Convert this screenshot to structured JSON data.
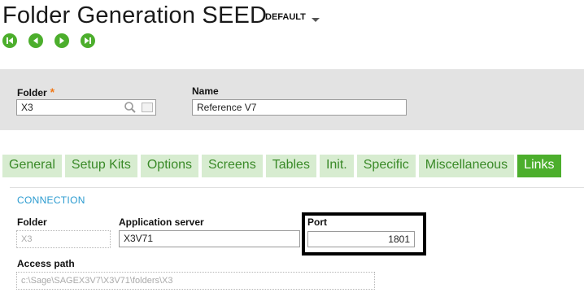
{
  "header": {
    "title": "Folder Generation SEED",
    "variant": "DEFAULT"
  },
  "nav_icons": [
    "first-record-icon",
    "previous-record-icon",
    "next-record-icon",
    "last-record-icon"
  ],
  "colors": {
    "accent": "#4cae2c",
    "tab_inactive": "#d7ecd0",
    "section_title": "#2b9bd0",
    "required": "#f07818"
  },
  "form": {
    "folder_label": "Folder",
    "folder_required_mark": "*",
    "folder_value": "X3",
    "name_label": "Name",
    "name_value": "Reference V7"
  },
  "tabs": [
    {
      "label": "General"
    },
    {
      "label": "Setup Kits"
    },
    {
      "label": "Options"
    },
    {
      "label": "Screens"
    },
    {
      "label": "Tables"
    },
    {
      "label": "Init."
    },
    {
      "label": "Specific"
    },
    {
      "label": "Miscellaneous"
    },
    {
      "label": "Links",
      "active": true
    }
  ],
  "links": {
    "section_title": "CONNECTION",
    "folder_label": "Folder",
    "folder_value": "X3",
    "app_server_label": "Application server",
    "app_server_value": "X3V71",
    "port_label": "Port",
    "port_value": "1801",
    "access_path_label": "Access path",
    "access_path_value": "c:\\Sage\\SAGEX3V7\\X3V71\\folders\\X3"
  }
}
